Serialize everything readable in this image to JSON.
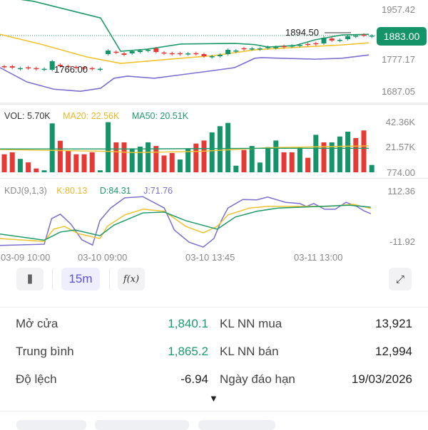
{
  "price_chart": {
    "axis_labels": [
      "1957.42",
      "1777.17",
      "1687.05"
    ],
    "current_price": "1883.00",
    "high_note": "1894.50",
    "low_note": "1766.00",
    "colors": {
      "up": "#15946a",
      "down": "#e53935",
      "upper": "#1f9a6a",
      "middle": "#f0c22c",
      "lower": "#7a6fd0"
    }
  },
  "volume": {
    "legend": {
      "vol": "VOL: 5.70K",
      "ma20": "MA20: 22.56K",
      "ma50": "MA50: 20.51K"
    },
    "axis_labels": [
      "42.36K",
      "21.57K",
      "774.00"
    ]
  },
  "kdj": {
    "legend": {
      "name": "KDJ(9,1,3)",
      "k": "K:80.13",
      "d": "D:84.31",
      "j": "J:71.76"
    },
    "axis_labels": [
      "112.36",
      "-11.92"
    ]
  },
  "time_labels": [
    "03-09 10:00",
    "03-10 09:00",
    "03-10 13:45",
    "03-11 13:00"
  ],
  "toolbar": {
    "interval": "15m",
    "indicator": "f(x)",
    "candle_icon": "candlestick-icon",
    "expand_icon": "expand-icon"
  },
  "stats": [
    {
      "label": "Mở cửa",
      "value": "1,840.1",
      "label2": "KL NN mua",
      "value2": "13,921"
    },
    {
      "label": "Trung bình",
      "value": "1,865.2",
      "label2": "KL NN bán",
      "value2": "12,994"
    },
    {
      "label": "Độ lệch",
      "value": "-6.94",
      "label2": "Ngày đáo hạn",
      "value2": "19/03/2026"
    }
  ],
  "expand_arrow": "▼",
  "chart_data": {
    "type": "candlestick",
    "price_range": [
      1687.05,
      1957.42
    ],
    "candles": [
      [
        1771.8,
        1769.4
      ],
      [
        1771.8,
        1767.1
      ],
      [
        1764.7,
        1765.5
      ],
      [
        1768,
        1767.1
      ],
      [
        1765.5,
        1764.7
      ],
      [
        1762.4,
        1763.2
      ],
      [
        1760,
        1788.2
      ],
      [
        1776.5,
        1771.8
      ],
      [
        1772.5,
        1771.8
      ],
      [
        1769.4,
        1767.1
      ],
      [
        1767.8,
        1767.1
      ],
      [
        1765.5,
        1764.7
      ],
      [
        1762.4,
        1763.2
      ],
      [
        1811.7,
        1823.5
      ],
      [
        1819.5,
        1818.8
      ],
      [
        1814.1,
        1809.4
      ],
      [
        1814.1,
        1821.1
      ],
      [
        1818.8,
        1823.5
      ],
      [
        1825,
        1825.8
      ],
      [
        1830.5,
        1818.8
      ],
      [
        1817,
        1816.4
      ],
      [
        1814.8,
        1814.1
      ],
      [
        1814.8,
        1814.1
      ],
      [
        1813.3,
        1814.1
      ],
      [
        1814.8,
        1814.1
      ],
      [
        1811.7,
        1804.7
      ],
      [
        1804,
        1804.7
      ],
      [
        1804.7,
        1809.4
      ],
      [
        1811.7,
        1825.8
      ],
      [
        1822.7,
        1823.5
      ],
      [
        1831.2,
        1830.5
      ],
      [
        1829.7,
        1830.5
      ],
      [
        1829.7,
        1830.5
      ],
      [
        1834.4,
        1835.2
      ],
      [
        1834.4,
        1835.2
      ],
      [
        1838.3,
        1837.6
      ],
      [
        1839.1,
        1839.9
      ],
      [
        1841.5,
        1842.3
      ],
      [
        1845.3,
        1844.6
      ],
      [
        1847.7,
        1847
      ],
      [
        1847,
        1865.8
      ],
      [
        1863.4,
        1856.4
      ],
      [
        1858,
        1858.7
      ],
      [
        1861.1,
        1870.5
      ],
      [
        1872,
        1872.8
      ],
      [
        1875.9,
        1875.2
      ],
      [
        1872,
        1872.8
      ]
    ],
    "boll_upper": [
      [
        0,
        2002
      ],
      [
        5,
        1986
      ],
      [
        15,
        1931
      ],
      [
        18,
        1821
      ],
      [
        22,
        1828
      ],
      [
        27,
        1845
      ],
      [
        35,
        1847
      ],
      [
        38,
        1843
      ],
      [
        40,
        1835
      ],
      [
        44,
        1840
      ],
      [
        47,
        1859
      ],
      [
        51,
        1875
      ],
      [
        55,
        1877
      ]
    ],
    "boll_middle": [
      [
        0,
        1877
      ],
      [
        6,
        1845
      ],
      [
        13,
        1802
      ],
      [
        18,
        1781
      ],
      [
        27,
        1798
      ],
      [
        32,
        1807
      ],
      [
        38,
        1826
      ],
      [
        45,
        1835
      ],
      [
        51,
        1842
      ],
      [
        55,
        1849
      ]
    ],
    "boll_lower": [
      [
        0,
        1767
      ],
      [
        4,
        1720
      ],
      [
        8,
        1696
      ],
      [
        12,
        1689
      ],
      [
        15,
        1699
      ],
      [
        17,
        1732
      ],
      [
        19,
        1739
      ],
      [
        23,
        1732
      ],
      [
        31,
        1755
      ],
      [
        35,
        1767
      ],
      [
        38,
        1798
      ],
      [
        39,
        1800
      ],
      [
        47,
        1795
      ],
      [
        51,
        1798
      ],
      [
        55,
        1809
      ]
    ],
    "volumes_k": [
      15.6,
      17.2,
      11.8,
      8.9,
      3.9,
      2.4,
      41,
      26.7,
      18.5,
      15.6,
      15.6,
      17.2,
      2.4,
      42,
      25.4,
      25.4,
      20.5,
      21.9,
      25.4,
      22.4,
      14.6,
      16.6,
      11.3,
      20.5,
      24.4,
      26.9,
      33.6,
      38.7,
      41.4,
      6.2,
      19.1,
      22.4,
      8.8,
      21.5,
      26.9,
      17.2,
      17.2,
      21.1,
      12.7,
      31.6,
      25.4,
      25.4,
      30.2,
      34.2,
      28.9,
      35.2,
      6.8
    ],
    "volume_up": [
      0,
      0,
      1,
      0,
      0,
      1,
      1,
      0,
      0,
      0,
      0,
      0,
      1,
      1,
      0,
      0,
      1,
      1,
      1,
      0,
      0,
      0,
      1,
      1,
      0,
      0,
      1,
      1,
      1,
      1,
      0,
      1,
      1,
      1,
      1,
      0,
      0,
      1,
      0,
      1,
      0,
      1,
      1,
      1,
      0,
      0,
      1
    ],
    "volume_range_k": [
      0.774,
      42.36
    ],
    "vol_ma20_k": [
      [
        0,
        19.5
      ],
      [
        16,
        18
      ],
      [
        20,
        17
      ],
      [
        30,
        18
      ],
      [
        40,
        21
      ],
      [
        50,
        22
      ],
      [
        55,
        22.5
      ]
    ],
    "vol_ma50_k": [
      [
        0,
        20
      ],
      [
        20,
        20
      ],
      [
        40,
        20.5
      ],
      [
        55,
        20.5
      ]
    ],
    "kdj_range": [
      -11.92,
      112.36
    ],
    "J": [
      [
        0,
        -22
      ],
      [
        6.6,
        -19
      ],
      [
        7.7,
        44
      ],
      [
        9,
        55
      ],
      [
        10.6,
        30
      ],
      [
        12.2,
        -8
      ],
      [
        13.8,
        -21
      ],
      [
        14.9,
        39
      ],
      [
        16.5,
        70
      ],
      [
        18.6,
        95
      ],
      [
        21.3,
        98
      ],
      [
        24.5,
        70
      ],
      [
        26,
        16
      ],
      [
        28.2,
        -14
      ],
      [
        30.3,
        -26
      ],
      [
        31.9,
        -5
      ],
      [
        33,
        39
      ],
      [
        34,
        70
      ],
      [
        36.2,
        91
      ],
      [
        38.3,
        90
      ],
      [
        39.9,
        97
      ],
      [
        42.6,
        84
      ],
      [
        44.7,
        81
      ],
      [
        45.7,
        74
      ],
      [
        46.8,
        81
      ],
      [
        48.4,
        67
      ],
      [
        50,
        67
      ],
      [
        51.6,
        84
      ],
      [
        53.2,
        74
      ],
      [
        54.3,
        63
      ],
      [
        55.3,
        56
      ]
    ],
    "K": [
      [
        0,
        -5
      ],
      [
        6.6,
        -12
      ],
      [
        8,
        18
      ],
      [
        9.6,
        25
      ],
      [
        11.7,
        7
      ],
      [
        14.9,
        -5
      ],
      [
        16,
        25
      ],
      [
        18.6,
        53
      ],
      [
        21.3,
        67
      ],
      [
        24.5,
        62
      ],
      [
        27.7,
        25
      ],
      [
        30.3,
        9
      ],
      [
        32.4,
        25
      ],
      [
        34,
        53
      ],
      [
        37.2,
        70
      ],
      [
        39.9,
        74
      ],
      [
        44.7,
        74
      ],
      [
        48.9,
        74
      ],
      [
        52.7,
        79
      ],
      [
        55.3,
        69
      ]
    ],
    "D": [
      [
        0,
        6
      ],
      [
        6.6,
        -9
      ],
      [
        9,
        11
      ],
      [
        11.2,
        16
      ],
      [
        14.9,
        2
      ],
      [
        17,
        28
      ],
      [
        21.3,
        58
      ],
      [
        24.5,
        60
      ],
      [
        27.7,
        39
      ],
      [
        32.4,
        18
      ],
      [
        35.1,
        48
      ],
      [
        38.3,
        62
      ],
      [
        41.5,
        70
      ],
      [
        47.9,
        74
      ],
      [
        52.1,
        77
      ],
      [
        55.3,
        72
      ]
    ]
  }
}
